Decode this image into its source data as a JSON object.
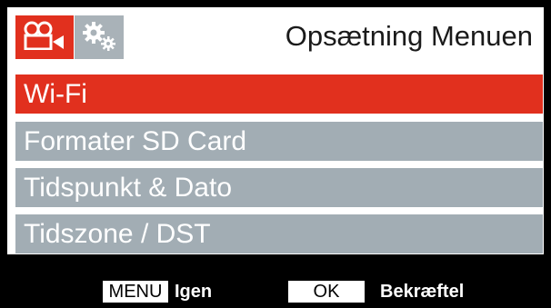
{
  "header": {
    "title": "Opsætning Menuen",
    "tabs": [
      {
        "icon": "video-camera-icon",
        "active": true
      },
      {
        "icon": "gears-icon",
        "active": false
      }
    ]
  },
  "menu": {
    "items": [
      {
        "label": "Wi-Fi",
        "selected": true
      },
      {
        "label": "Formater SD Card",
        "selected": false
      },
      {
        "label": "Tidspunkt & Dato",
        "selected": false
      },
      {
        "label": "Tidszone / DST",
        "selected": false
      }
    ]
  },
  "footer": {
    "menu_key": "MENU",
    "menu_action": "Igen",
    "ok_key": "OK",
    "ok_action": "Bekræftel"
  },
  "colors": {
    "accent": "#e1301e",
    "item_background": "#a2adb4",
    "tab_inactive": "#a9b2b8",
    "screen_background": "#000000"
  }
}
